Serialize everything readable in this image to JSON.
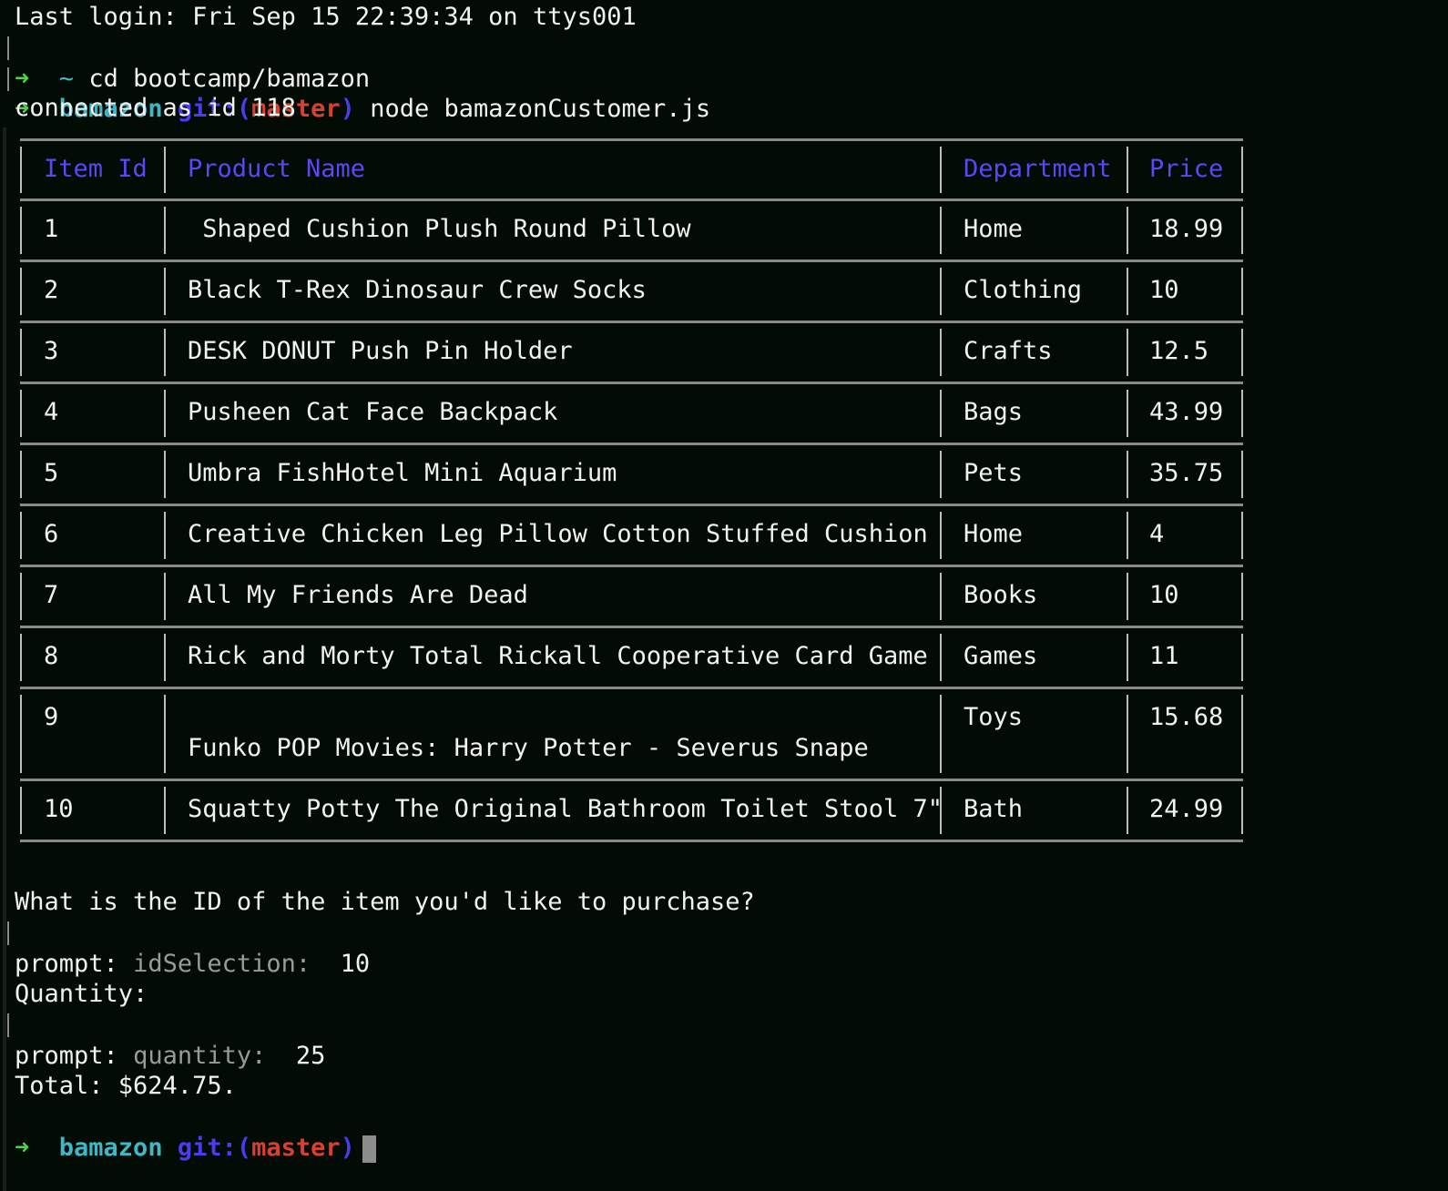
{
  "terminal": {
    "last_login": "Last login: Fri Sep 15 22:39:34 on ttys001",
    "cmd1": {
      "arrow": "➜",
      "dir": "~",
      "command": "cd bootcamp/bamazon"
    },
    "cmd2": {
      "arrow": "➜",
      "dir": "bamazon",
      "git_label": "git:(",
      "branch": "master",
      "git_close": ")",
      "command": "node bamazonCustomer.js"
    },
    "connected": "connected as id 118",
    "table": {
      "headers": [
        "Item Id",
        "Product Name",
        "Department",
        "Price"
      ],
      "rows": [
        {
          "id": "1",
          "name": " Shaped Cushion Plush Round Pillow",
          "name2": "",
          "dept": "Home",
          "price": "18.99"
        },
        {
          "id": "2",
          "name": "Black T-Rex Dinosaur Crew Socks",
          "name2": "",
          "dept": "Clothing",
          "price": "10"
        },
        {
          "id": "3",
          "name": "DESK DONUT Push Pin Holder",
          "name2": "",
          "dept": "Crafts",
          "price": "12.5"
        },
        {
          "id": "4",
          "name": "Pusheen Cat Face Backpack",
          "name2": "",
          "dept": "Bags",
          "price": "43.99"
        },
        {
          "id": "5",
          "name": "Umbra FishHotel Mini Aquarium",
          "name2": "",
          "dept": "Pets",
          "price": "35.75"
        },
        {
          "id": "6",
          "name": "Creative Chicken Leg Pillow Cotton Stuffed Cushion",
          "name2": "",
          "dept": "Home",
          "price": "4"
        },
        {
          "id": "7",
          "name": "All My Friends Are Dead",
          "name2": "",
          "dept": "Books",
          "price": "10"
        },
        {
          "id": "8",
          "name": "Rick and Morty Total Rickall Cooperative Card Game",
          "name2": "",
          "dept": "Games",
          "price": "11"
        },
        {
          "id": "9",
          "name": "",
          "name2": "Funko POP Movies: Harry Potter - Severus Snape",
          "dept": "Toys",
          "price": "15.68"
        },
        {
          "id": "10",
          "name": "Squatty Potty The Original Bathroom Toilet Stool 7\"",
          "name2": "",
          "dept": "Bath",
          "price": "24.99"
        }
      ]
    },
    "question_id": "What is the ID of the item you'd like to purchase?",
    "prompt_id": {
      "label": "prompt:",
      "field": "idSelection:",
      "value": "10"
    },
    "question_qty": "Quantity:",
    "prompt_qty": {
      "label": "prompt:",
      "field": "quantity:",
      "value": "25"
    },
    "total": "Total: $624.75.",
    "final_prompt": {
      "arrow": "➜",
      "dir": "bamazon",
      "git_label": "git:(",
      "branch": "master",
      "git_close": ")"
    },
    "colors": {
      "background": "#030b05",
      "arrow": "#4fd34a",
      "dir": "#3fb7c6",
      "git": "#4a3df0",
      "branch": "#d9412f",
      "header": "#5a48f5"
    }
  }
}
